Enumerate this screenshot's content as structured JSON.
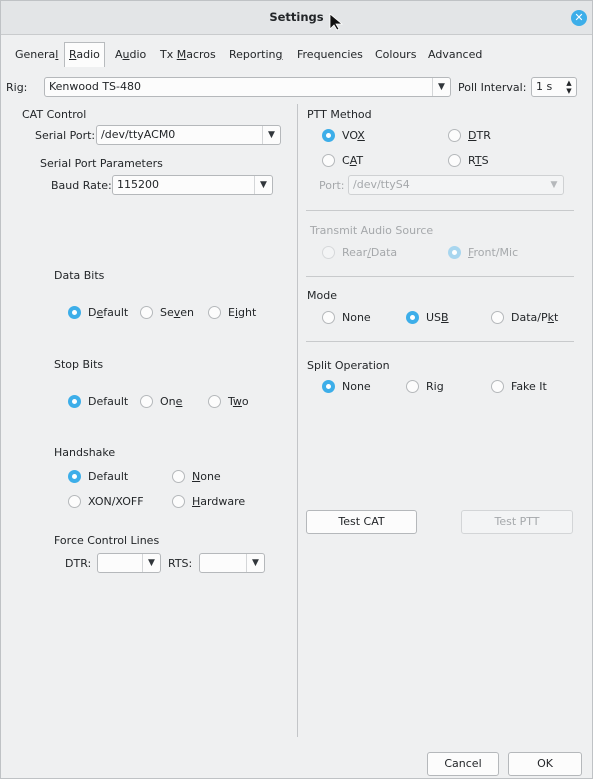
{
  "window": {
    "title": "Settings",
    "accent_color": "#3daee9"
  },
  "tabs": [
    {
      "label": "General",
      "active": false
    },
    {
      "label": "Radio",
      "active": true
    },
    {
      "label": "Audio",
      "active": false
    },
    {
      "label": "Tx Macros",
      "active": false
    },
    {
      "label": "Reporting",
      "active": false
    },
    {
      "label": "Frequencies",
      "active": false
    },
    {
      "label": "Colours",
      "active": false
    },
    {
      "label": "Advanced",
      "active": false
    }
  ],
  "rig": {
    "label": "Rig:",
    "value": "Kenwood TS-480",
    "poll_label": "Poll Interval:",
    "poll_value": "1 s"
  },
  "cat": {
    "heading": "CAT Control",
    "serial_port_label": "Serial Port:",
    "serial_port_value": "/dev/ttyACM0",
    "params_heading": "Serial Port Parameters",
    "baud_label": "Baud Rate:",
    "baud_value": "115200",
    "data_bits": {
      "heading": "Data Bits",
      "options": [
        "Default",
        "Seven",
        "Eight"
      ],
      "selected": "Default"
    },
    "stop_bits": {
      "heading": "Stop Bits",
      "options": [
        "Default",
        "One",
        "Two"
      ],
      "selected": "Default"
    },
    "handshake": {
      "heading": "Handshake",
      "options": [
        "Default",
        "None",
        "XON/XOFF",
        "Hardware"
      ],
      "selected": "Default"
    },
    "force": {
      "heading": "Force Control Lines",
      "dtr_label": "DTR:",
      "dtr_value": "",
      "rts_label": "RTS:",
      "rts_value": ""
    }
  },
  "ptt": {
    "heading": "PTT Method",
    "options": [
      "VOX",
      "DTR",
      "CAT",
      "RTS"
    ],
    "selected": "VOX",
    "port_label": "Port:",
    "port_value": "/dev/ttyS4"
  },
  "tx_audio": {
    "heading": "Transmit Audio Source",
    "options": [
      "Rear/Data",
      "Front/Mic"
    ],
    "selected": "Front/Mic"
  },
  "mode": {
    "heading": "Mode",
    "options": [
      "None",
      "USB",
      "Data/Pkt"
    ],
    "selected": "USB"
  },
  "split": {
    "heading": "Split Operation",
    "options": [
      "None",
      "Rig",
      "Fake It"
    ],
    "selected": "None"
  },
  "buttons": {
    "test_cat": "Test CAT",
    "test_ptt": "Test PTT",
    "cancel": "Cancel",
    "ok": "OK"
  }
}
